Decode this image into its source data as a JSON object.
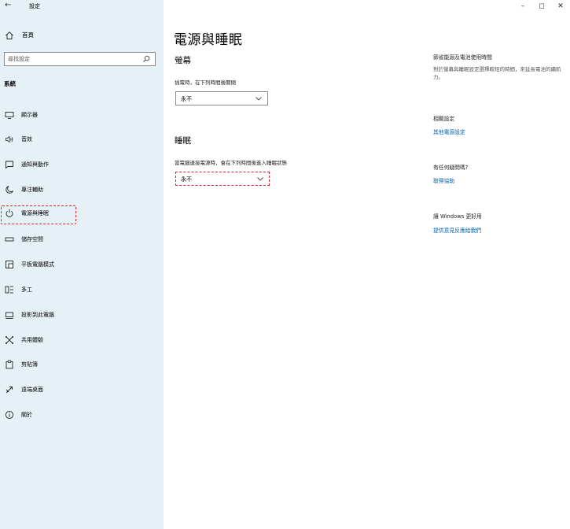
{
  "window": {
    "title": "設定",
    "back_glyph": "←",
    "minimize_glyph": "–",
    "maximize_glyph": "◻",
    "close_glyph": "✕"
  },
  "sidebar": {
    "home_label": "首頁",
    "search": {
      "placeholder": "尋找設定"
    },
    "section_label": "系統",
    "items": [
      {
        "label": "顯示器",
        "icon": "monitor-icon"
      },
      {
        "label": "音效",
        "icon": "speaker-icon"
      },
      {
        "label": "通知與動作",
        "icon": "notification-icon"
      },
      {
        "label": "專注輔助",
        "icon": "moon-icon"
      },
      {
        "label": "電源與睡眠",
        "icon": "power-icon",
        "active": true
      },
      {
        "label": "儲存空間",
        "icon": "storage-icon"
      },
      {
        "label": "平板電腦模式",
        "icon": "tablet-icon"
      },
      {
        "label": "多工",
        "icon": "multitasking-icon"
      },
      {
        "label": "投影到此電腦",
        "icon": "projector-icon"
      },
      {
        "label": "共用體驗",
        "icon": "shared-experience-icon"
      },
      {
        "label": "剪貼簿",
        "icon": "clipboard-icon"
      },
      {
        "label": "遠端桌面",
        "icon": "remote-desktop-icon"
      },
      {
        "label": "關於",
        "icon": "info-icon"
      }
    ]
  },
  "main": {
    "title": "電源與睡眠",
    "screen": {
      "heading": "螢幕",
      "label": "插電時，在下列時間後關閉",
      "value": "永不"
    },
    "sleep": {
      "heading": "睡眠",
      "label": "當電腦連接電源時，會在下列時間後進入睡眠狀態",
      "value": "永不"
    }
  },
  "related": {
    "battery": {
      "heading": "節省能源及電池使用時間",
      "text": "對於螢幕與睡眠設定選擇較短的時間，來延長電池的續航力。"
    },
    "settings": {
      "heading": "相關設定",
      "link": "其他電源設定"
    },
    "help": {
      "heading": "有任何疑問嗎?",
      "link": "取得協助"
    },
    "feedback": {
      "heading": "讓 Windows 更好用",
      "link": "提供意見反應給我們"
    }
  },
  "colors": {
    "sidebar_bg": "#e6f1f7",
    "link": "#0063b1",
    "highlight": "#d6272b"
  }
}
